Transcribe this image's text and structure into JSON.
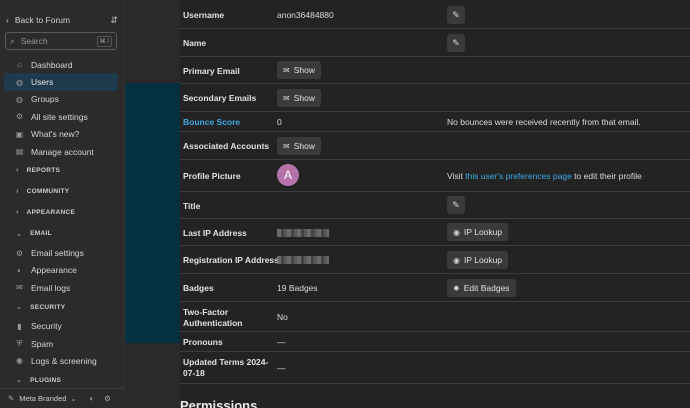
{
  "sidebar": {
    "back_label": "Back to Forum",
    "search_placeholder": "Search",
    "search_shortcut": "⌘ /",
    "items_top": [
      {
        "label": "Dashboard",
        "icon": "home-icon",
        "glyph": "⌂"
      },
      {
        "label": "Users",
        "icon": "users-icon",
        "glyph": "👥"
      },
      {
        "label": "Groups",
        "icon": "groups-icon",
        "glyph": "👥"
      },
      {
        "label": "All site settings",
        "icon": "gear-icon",
        "glyph": "⚙"
      },
      {
        "label": "What's new?",
        "icon": "gift-icon",
        "glyph": "▣"
      },
      {
        "label": "Manage account",
        "icon": "id-card-icon",
        "glyph": "▤"
      }
    ],
    "sections": {
      "reports": "REPORTS",
      "community": "COMMUNITY",
      "appearance": "APPEARANCE",
      "email": "EMAIL",
      "security": "SECURITY",
      "plugins": "PLUGINS"
    },
    "email_items": [
      {
        "label": "Email settings",
        "icon": "gear-icon",
        "glyph": "⚙"
      },
      {
        "label": "Appearance",
        "icon": "palette-icon",
        "glyph": "◐"
      },
      {
        "label": "Email logs",
        "icon": "envelope-icon",
        "glyph": "✉"
      }
    ],
    "security_items": [
      {
        "label": "Security",
        "icon": "lock-icon",
        "glyph": "🔒"
      },
      {
        "label": "Spam",
        "icon": "shield-icon",
        "glyph": "⛨"
      },
      {
        "label": "Logs & screening",
        "icon": "user-lock-icon",
        "glyph": "👤"
      }
    ],
    "footer": {
      "label": "Meta Branded",
      "icon": "brush-icon",
      "right_icons": "◐ ⚙"
    }
  },
  "user": {
    "username_label": "Username",
    "username_value": "anon36484880",
    "name_label": "Name",
    "primary_email_label": "Primary Email",
    "secondary_emails_label": "Secondary Emails",
    "show_label": "Show",
    "bounce_score_label": "Bounce Score",
    "bounce_score_value": "0",
    "bounce_note": "No bounces were received recently from that email.",
    "associated_accounts_label": "Associated Accounts",
    "profile_picture_label": "Profile Picture",
    "avatar_letter": "A",
    "profile_visit": "Visit",
    "profile_link": "this user's preferences page",
    "profile_suffix": "to edit their profile",
    "title_label": "Title",
    "last_ip_label": "Last IP Address",
    "registration_ip_label": "Registration IP Address",
    "ip_lookup_label": "IP Lookup",
    "badges_label": "Badges",
    "badges_value": "19 Badges",
    "edit_badges_label": "Edit Badges",
    "two_factor_label_1": "Two-Factor",
    "two_factor_label_2": "Authentication",
    "two_factor_value": "No",
    "pronouns_label": "Pronouns",
    "pronouns_value": "—",
    "terms_label_1": "Updated Terms 2024-",
    "terms_label_2": "07-18",
    "terms_value": "—",
    "permissions_heading": "Permissions"
  },
  "colors": {
    "accent": "#3fa9e6",
    "active_nav": "#1f3a4d",
    "avatar": "#b574a9",
    "background": "#222222"
  }
}
